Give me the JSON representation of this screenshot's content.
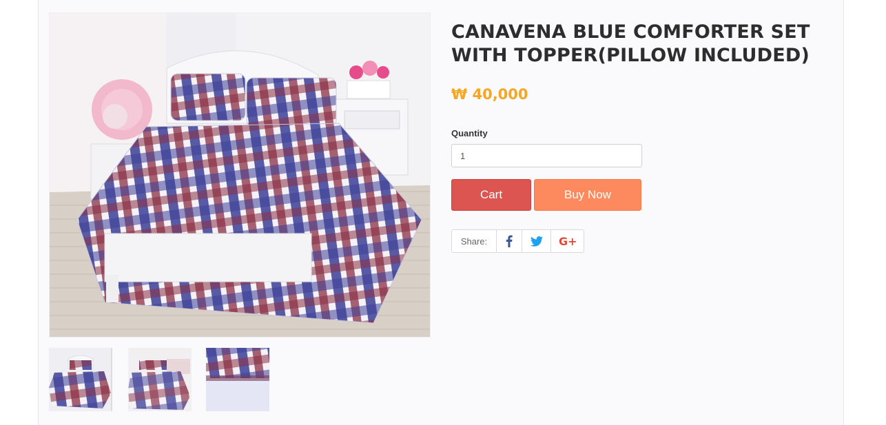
{
  "product": {
    "title": "CANAVENA BLUE COMFORTER SET WITH TOPPER(PILLOW INCLUDED)",
    "price": "₩ 40,000",
    "main_image_icon": "bedroom-plaid-comforter-photo",
    "thumbnails": [
      {
        "icon": "bed-plaid-photo",
        "selected": true
      },
      {
        "icon": "bed-plaid-photo-2",
        "selected": false
      },
      {
        "icon": "fabric-closeup-photo",
        "selected": false
      }
    ]
  },
  "purchase": {
    "quantity_label": "Quantity",
    "quantity_value": "1",
    "cart_label": "Cart",
    "buy_now_label": "Buy Now"
  },
  "share": {
    "label": "Share:",
    "buttons": [
      {
        "icon": "facebook-icon",
        "color": "#3b5998"
      },
      {
        "icon": "twitter-icon",
        "color": "#1da1f2"
      },
      {
        "icon": "google-plus-icon",
        "color": "#dd4b39"
      }
    ]
  },
  "colors": {
    "price": "#f5a623",
    "cart": "#dc5550",
    "buy_now": "#fd8a5e"
  }
}
